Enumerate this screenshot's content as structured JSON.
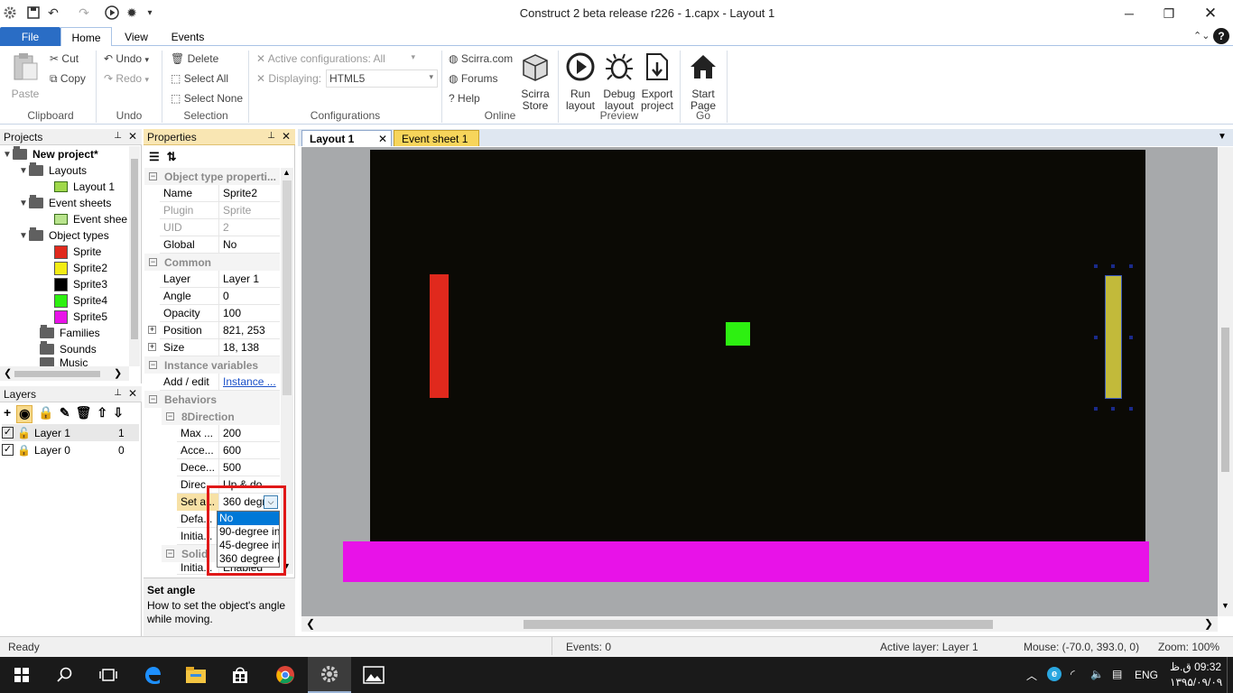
{
  "window": {
    "title": "Construct 2 beta release r226 - 1.capx - Layout 1"
  },
  "ribbon_tabs": [
    "File",
    "Home",
    "View",
    "Events"
  ],
  "ribbon": {
    "paste": "Paste",
    "cut": "Cut",
    "copy": "Copy",
    "undo": "Undo",
    "redo": "Redo",
    "delete": "Delete",
    "select_all": "Select All",
    "select_none": "Select None",
    "active_configurations": "Active configurations: All",
    "displaying_label": "Displaying:",
    "displaying_value": "HTML5",
    "scirra_com": "Scirra.com",
    "forums": "Forums",
    "help": "Help",
    "scirra_store": "Scirra Store",
    "run_layout": "Run layout",
    "debug_layout": "Debug layout",
    "export_project": "Export project",
    "start_page": "Start Page",
    "groups": {
      "clipboard": "Clipboard",
      "undo": "Undo",
      "selection": "Selection",
      "configurations": "Configurations",
      "online": "Online",
      "preview": "Preview",
      "go": "Go"
    }
  },
  "projects": {
    "title": "Projects",
    "root": "New project*",
    "layouts": "Layouts",
    "layout1": "Layout 1",
    "event_sheets": "Event sheets",
    "event_sheet": "Event shee",
    "object_types": "Object types",
    "sprites": [
      {
        "label": "Sprite",
        "color": "#e0291d"
      },
      {
        "label": "Sprite2",
        "color": "#f3ec14"
      },
      {
        "label": "Sprite3",
        "color": "#000000"
      },
      {
        "label": "Sprite4",
        "color": "#2df011"
      },
      {
        "label": "Sprite5",
        "color": "#e812e8"
      }
    ],
    "families": "Families",
    "sounds": "Sounds",
    "music": "Music"
  },
  "layers": {
    "title": "Layers",
    "items": [
      {
        "name": "Layer 1",
        "index": "1"
      },
      {
        "name": "Layer 0",
        "index": "0"
      }
    ]
  },
  "properties": {
    "title": "Properties",
    "cat_object": "Object type properti...",
    "name_k": "Name",
    "name_v": "Sprite2",
    "plugin_k": "Plugin",
    "plugin_v": "Sprite",
    "uid_k": "UID",
    "uid_v": "2",
    "global_k": "Global",
    "global_v": "No",
    "cat_common": "Common",
    "layer_k": "Layer",
    "layer_v": "Layer 1",
    "angle_k": "Angle",
    "angle_v": "0",
    "opacity_k": "Opacity",
    "opacity_v": "100",
    "position_k": "Position",
    "position_v": "821, 253",
    "size_k": "Size",
    "size_v": "18, 138",
    "cat_instvars": "Instance variables",
    "addedit_k": "Add / edit",
    "addedit_v": "Instance ...",
    "cat_behaviors": "Behaviors",
    "cat_8dir": "8Direction",
    "maxspeed_k": "Max ...",
    "maxspeed_v": "200",
    "accel_k": "Acce...",
    "accel_v": "600",
    "decel_k": "Dece...",
    "decel_v": "500",
    "direc_k": "Direc...",
    "direc_v": "Up & do...",
    "setangle_k": "Set a...",
    "setangle_v": "360 degre",
    "defa_k": "Defa...",
    "initial_k": "Initia...",
    "cat_solid": "Solid",
    "solid_initial_k": "Initia...",
    "solid_initial_v": "Enabled",
    "dropdown": [
      "No",
      "90-degree in",
      "45-degree in",
      "360 degree ("
    ],
    "help_title": "Set angle",
    "help_text": "How to set the object's angle while moving."
  },
  "doc_tabs": [
    "Layout 1",
    "Event sheet 1"
  ],
  "status": {
    "ready": "Ready",
    "events": "Events: 0",
    "active_layer": "Active layer: Layer 1",
    "mouse": "Mouse: (-70.0, 393.0, 0)",
    "zoom": "Zoom: 100%"
  },
  "taskbar": {
    "lang": "ENG",
    "time": "09:32 ق.ظ",
    "date": "۱۳۹۵/۰۹/۰۹"
  }
}
